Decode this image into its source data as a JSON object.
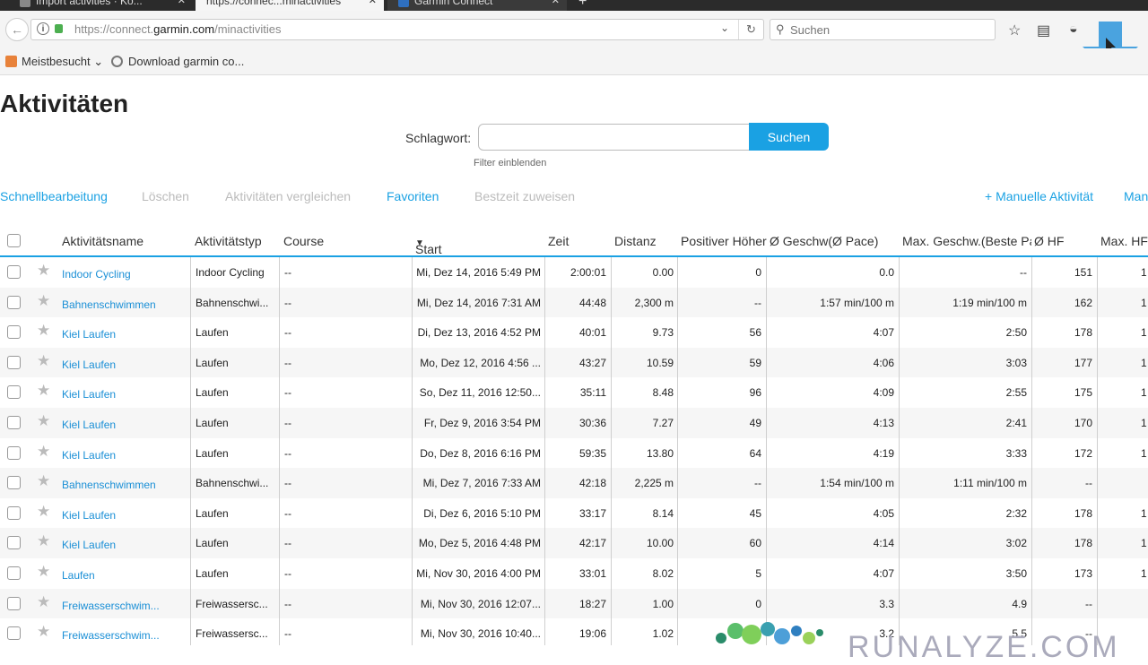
{
  "browser": {
    "tabs": [
      {
        "label": "Import activities · Ko..."
      },
      {
        "label": "https://connec...minactivities"
      },
      {
        "label": "Garmin Connect"
      }
    ],
    "url_prefix": "https://connect.",
    "url_host": "garmin.com",
    "url_path": "/minactivities",
    "search_placeholder": "Suchen",
    "bookmarks": [
      {
        "label": "Meistbesucht"
      },
      {
        "label": "Download garmin co..."
      }
    ]
  },
  "page": {
    "title": "Aktivitäten",
    "keyword_label": "Schlagwort:",
    "keyword_value": "",
    "search_button": "Suchen",
    "filter_link": "Filter einblenden"
  },
  "toolbar": {
    "quick_edit": "Schnellbearbeitung",
    "delete": "Löschen",
    "compare": "Aktivitäten vergleichen",
    "favorites": "Favoriten",
    "best_time": "Bestzeit zuweisen",
    "manual_activity": "+ Manuelle Aktivität",
    "manual_cut": "Man"
  },
  "table": {
    "columns": {
      "name": "Aktivitätsname",
      "type": "Aktivitätstyp",
      "course": "Course",
      "start": "Start",
      "time": "Zeit",
      "distance": "Distanz",
      "ascent": "Positiver Höher",
      "avg_speed": "Ø Geschw(Ø Pace)",
      "max_speed": "Max. Geschw.(Beste Pa",
      "avg_hr": "Ø HF",
      "max_hr": "Max. HF"
    },
    "rows": [
      {
        "name": "Indoor Cycling",
        "type": "Indoor Cycling",
        "course": "--",
        "start": "Mi, Dez 14, 2016 5:49 PM",
        "time": "2:00:01",
        "distance": "0.00",
        "ascent": "0",
        "avg_speed": "0.0",
        "max_speed": "--",
        "avg_hr": "151",
        "max_hr": "1"
      },
      {
        "name": "Bahnenschwimmen",
        "type": "Bahnenschwi...",
        "course": "--",
        "start": "Mi, Dez 14, 2016 7:31 AM",
        "time": "44:48",
        "distance": "2,300 m",
        "ascent": "--",
        "avg_speed": "1:57 min/100 m",
        "max_speed": "1:19 min/100 m",
        "avg_hr": "162",
        "max_hr": "1"
      },
      {
        "name": "Kiel Laufen",
        "type": "Laufen",
        "course": "--",
        "start": "Di, Dez 13, 2016 4:52 PM",
        "time": "40:01",
        "distance": "9.73",
        "ascent": "56",
        "avg_speed": "4:07",
        "max_speed": "2:50",
        "avg_hr": "178",
        "max_hr": "1"
      },
      {
        "name": "Kiel Laufen",
        "type": "Laufen",
        "course": "--",
        "start": "Mo, Dez 12, 2016 4:56 ...",
        "time": "43:27",
        "distance": "10.59",
        "ascent": "59",
        "avg_speed": "4:06",
        "max_speed": "3:03",
        "avg_hr": "177",
        "max_hr": "1"
      },
      {
        "name": "Kiel Laufen",
        "type": "Laufen",
        "course": "--",
        "start": "So, Dez 11, 2016 12:50...",
        "time": "35:11",
        "distance": "8.48",
        "ascent": "96",
        "avg_speed": "4:09",
        "max_speed": "2:55",
        "avg_hr": "175",
        "max_hr": "1"
      },
      {
        "name": "Kiel Laufen",
        "type": "Laufen",
        "course": "--",
        "start": "Fr, Dez 9, 2016 3:54 PM",
        "time": "30:36",
        "distance": "7.27",
        "ascent": "49",
        "avg_speed": "4:13",
        "max_speed": "2:41",
        "avg_hr": "170",
        "max_hr": "1"
      },
      {
        "name": "Kiel Laufen",
        "type": "Laufen",
        "course": "--",
        "start": "Do, Dez 8, 2016 6:16 PM",
        "time": "59:35",
        "distance": "13.80",
        "ascent": "64",
        "avg_speed": "4:19",
        "max_speed": "3:33",
        "avg_hr": "172",
        "max_hr": "1"
      },
      {
        "name": "Bahnenschwimmen",
        "type": "Bahnenschwi...",
        "course": "--",
        "start": "Mi, Dez 7, 2016 7:33 AM",
        "time": "42:18",
        "distance": "2,225 m",
        "ascent": "--",
        "avg_speed": "1:54 min/100 m",
        "max_speed": "1:11 min/100 m",
        "avg_hr": "--",
        "max_hr": ""
      },
      {
        "name": "Kiel Laufen",
        "type": "Laufen",
        "course": "--",
        "start": "Di, Dez 6, 2016 5:10 PM",
        "time": "33:17",
        "distance": "8.14",
        "ascent": "45",
        "avg_speed": "4:05",
        "max_speed": "2:32",
        "avg_hr": "178",
        "max_hr": "1"
      },
      {
        "name": "Kiel Laufen",
        "type": "Laufen",
        "course": "--",
        "start": "Mo, Dez 5, 2016 4:48 PM",
        "time": "42:17",
        "distance": "10.00",
        "ascent": "60",
        "avg_speed": "4:14",
        "max_speed": "3:02",
        "avg_hr": "178",
        "max_hr": "1"
      },
      {
        "name": "Laufen",
        "type": "Laufen",
        "course": "--",
        "start": "Mi, Nov 30, 2016 4:00 PM",
        "time": "33:01",
        "distance": "8.02",
        "ascent": "5",
        "avg_speed": "4:07",
        "max_speed": "3:50",
        "avg_hr": "173",
        "max_hr": "1"
      },
      {
        "name": "Freiwasserschwim...",
        "type": "Freiwassersc...",
        "course": "--",
        "start": "Mi, Nov 30, 2016 12:07...",
        "time": "18:27",
        "distance": "1.00",
        "ascent": "0",
        "avg_speed": "3.3",
        "max_speed": "4.9",
        "avg_hr": "--",
        "max_hr": ""
      },
      {
        "name": "Freiwasserschwim...",
        "type": "Freiwassersc...",
        "course": "--",
        "start": "Mi, Nov 30, 2016 10:40...",
        "time": "19:06",
        "distance": "1.02",
        "ascent": "",
        "avg_speed": "3.2",
        "max_speed": "5.5",
        "avg_hr": "--",
        "max_hr": ""
      }
    ]
  },
  "watermark": {
    "text": "RUNALYZE.COM"
  }
}
